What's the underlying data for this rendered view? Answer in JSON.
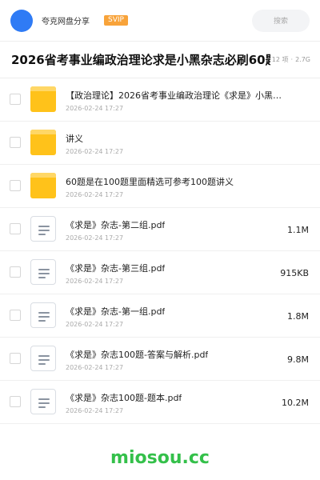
{
  "header": {
    "owner_name": "夸克网盘分享",
    "badge": "SVIP",
    "search_placeholder": "搜索",
    "avatar_color": "#2f7bf5"
  },
  "folder": {
    "title": "2026省考事业编政治理论求是小黑杂志必刷60题",
    "item_count": "12 项",
    "total_size": "2.7G"
  },
  "files": [
    {
      "type": "folder",
      "icon": "folder-icon",
      "name": "【政治理论】2026省考事业编政治理论《求是》小黑…",
      "date": "2026-02-24 17:27",
      "size": ""
    },
    {
      "type": "folder",
      "icon": "folder-icon",
      "name": "讲义",
      "date": "2026-02-24 17:27",
      "size": ""
    },
    {
      "type": "folder",
      "icon": "folder-icon",
      "name": "60题是在100题里面精选可参考100题讲义",
      "date": "2026-02-24 17:27",
      "size": ""
    },
    {
      "type": "file",
      "icon": "document-icon",
      "name": "《求是》杂志-第二组.pdf",
      "date": "2026-02-24 17:27",
      "size": "1.1M"
    },
    {
      "type": "file",
      "icon": "document-icon",
      "name": "《求是》杂志-第三组.pdf",
      "date": "2026-02-24 17:27",
      "size": "915KB"
    },
    {
      "type": "file",
      "icon": "document-icon",
      "name": "《求是》杂志-第一组.pdf",
      "date": "2026-02-24 17:27",
      "size": "1.8M"
    },
    {
      "type": "file",
      "icon": "document-icon",
      "name": "《求是》杂志100题-答案与解析.pdf",
      "date": "2026-02-24 17:27",
      "size": "9.8M"
    },
    {
      "type": "file",
      "icon": "document-icon",
      "name": "《求是》杂志100题-题本.pdf",
      "date": "2026-02-24 17:27",
      "size": "10.2M"
    }
  ],
  "watermark": "miosou.cc",
  "colors": {
    "folder_yellow": "#ffc21a",
    "svip_orange": "#f8a33a",
    "watermark_green": "#34c04a"
  }
}
